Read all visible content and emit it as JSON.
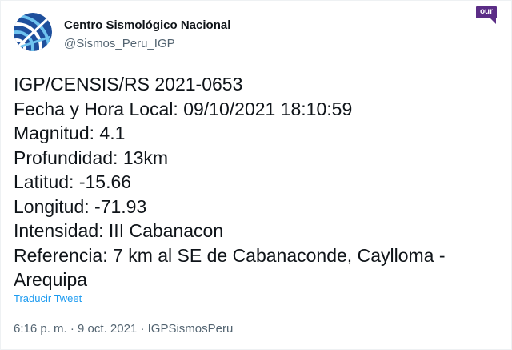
{
  "account": {
    "display_name": "Centro Sismológico Nacional",
    "handle": "@Sismos_Peru_IGP",
    "avatar_icon": "radar-globe-icon",
    "avatar_colors": [
      "#1e4f9c",
      "#6fc3ef"
    ]
  },
  "badge": {
    "label": "our",
    "color": "#5b2d86"
  },
  "tweet": {
    "lines": [
      "IGP/CENSIS/RS 2021-0653",
      "Fecha y Hora Local: 09/10/2021 18:10:59",
      "Magnitud: 4.1",
      "Profundidad: 13km",
      "Latitud: -15.66",
      "Longitud: -71.93",
      "Intensidad: III Cabanacon",
      "Referencia: 7 km al SE de Cabanaconde, Caylloma -",
      "Arequipa"
    ],
    "translate_label": "Traducir Tweet"
  },
  "meta": {
    "time": "6:16 p. m.",
    "separator": "·",
    "date": "9 oct. 2021",
    "source": "IGPSismosPeru"
  },
  "colors": {
    "text": "#0f1419",
    "secondary": "#536471",
    "link": "#1d9bf0"
  }
}
